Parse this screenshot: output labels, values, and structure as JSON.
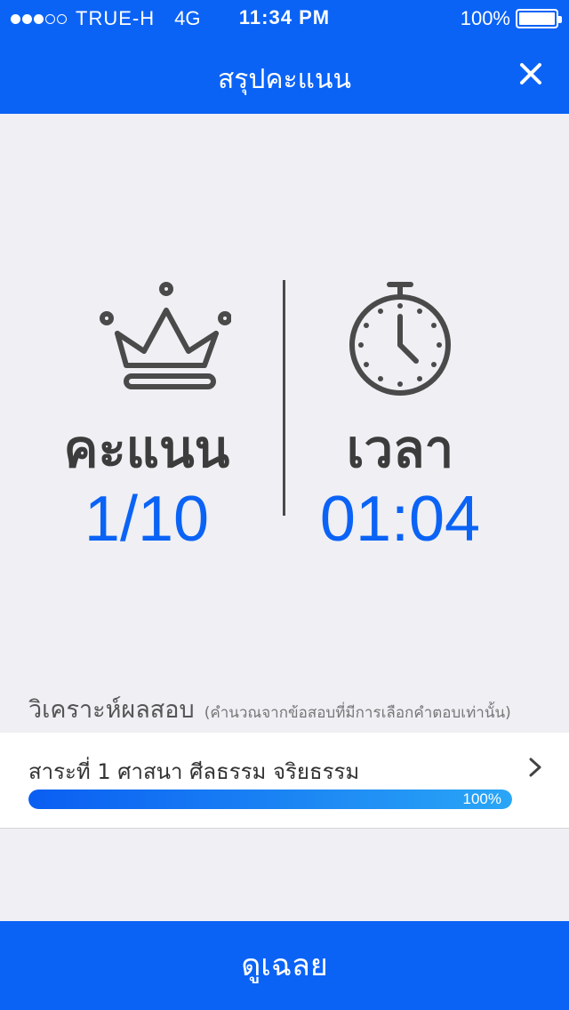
{
  "status_bar": {
    "carrier": "TRUE-H",
    "network": "4G",
    "time": "11:34 PM",
    "battery": "100%"
  },
  "nav": {
    "title": "สรุปคะแนน"
  },
  "score": {
    "label": "คะแนน",
    "value": "1/10"
  },
  "time": {
    "label": "เวลา",
    "value": "01:04"
  },
  "analysis": {
    "title": "วิเคราะห์ผลสอบ",
    "note": "(คำนวณจากข้อสอบที่มีการเลือกคำตอบเท่านั้น)"
  },
  "subjects": [
    {
      "name": "สาระที่ 1 ศาสนา ศีลธรรม จริยธรรม",
      "percent_label": "100%",
      "percent": 100
    }
  ],
  "footer": {
    "button_label": "ดูเฉลย"
  },
  "colors": {
    "primary": "#0b63f6",
    "text_dark": "#3c3c3c",
    "background": "#efeff4"
  }
}
